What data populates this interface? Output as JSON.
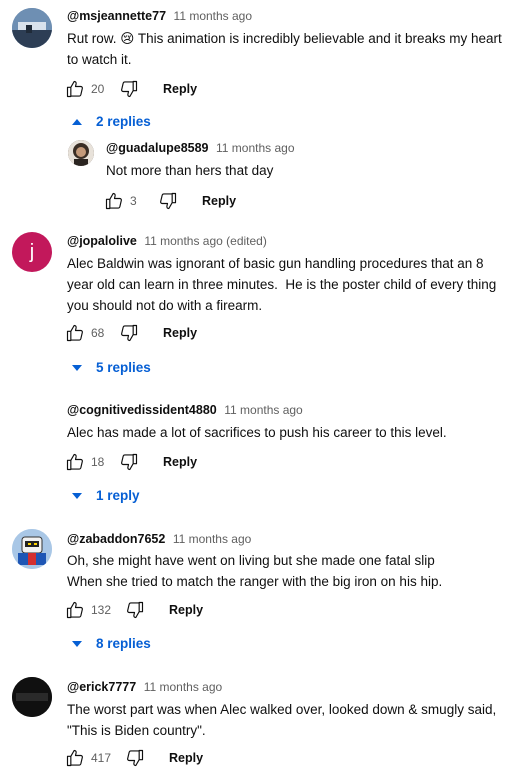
{
  "comments": [
    {
      "handle": "@msjeannette77",
      "time": "11 months ago",
      "text1": "Rut row. 😢 This animation is incredibly believable and it breaks my heart",
      "text2": "to watch it.",
      "likes": "20",
      "reply_label": "Reply",
      "replies_label": "2 replies"
    },
    {
      "handle": "@guadalupe8589",
      "time": "11 months ago",
      "text1": "Not more than hers that day",
      "likes": "3",
      "reply_label": "Reply"
    },
    {
      "handle": "@jopalolive",
      "time": "11 months ago (edited)",
      "avatar_letter": "j",
      "text1": "Alec Baldwin was ignorant of basic gun handling procedures that an 8",
      "text2": "year old can learn in three minutes.  He is the poster child of every thing",
      "text3": "you should not do with a firearm.",
      "likes": "68",
      "reply_label": "Reply",
      "replies_label": "5 replies"
    },
    {
      "handle": "@cognitivedissident4880",
      "time": "11 months ago",
      "text1": "Alec has made a lot of sacrifices to push his career to this level.",
      "likes": "18",
      "reply_label": "Reply",
      "replies_label": "1 reply"
    },
    {
      "handle": "@zabaddon7652",
      "time": "11 months ago",
      "text1": "Oh, she might have went on living but she made one fatal slip",
      "text2": "When she tried to match the ranger with the big iron on his hip.",
      "likes": "132",
      "reply_label": "Reply",
      "replies_label": "8 replies"
    },
    {
      "handle": "@erick7777",
      "time": "11 months ago",
      "text1": "The worst part was when Alec walked over, looked down & smugly said,",
      "text2": "\"This is Biden country\".",
      "likes": "417",
      "reply_label": "Reply"
    }
  ],
  "colors": {
    "link_blue": "#065fd4",
    "meta_gray": "#606060",
    "avatar_pink": "#c2185b"
  },
  "icons": [
    "thumbs-up-icon",
    "thumbs-down-icon",
    "caret-up-icon",
    "caret-down-icon"
  ]
}
